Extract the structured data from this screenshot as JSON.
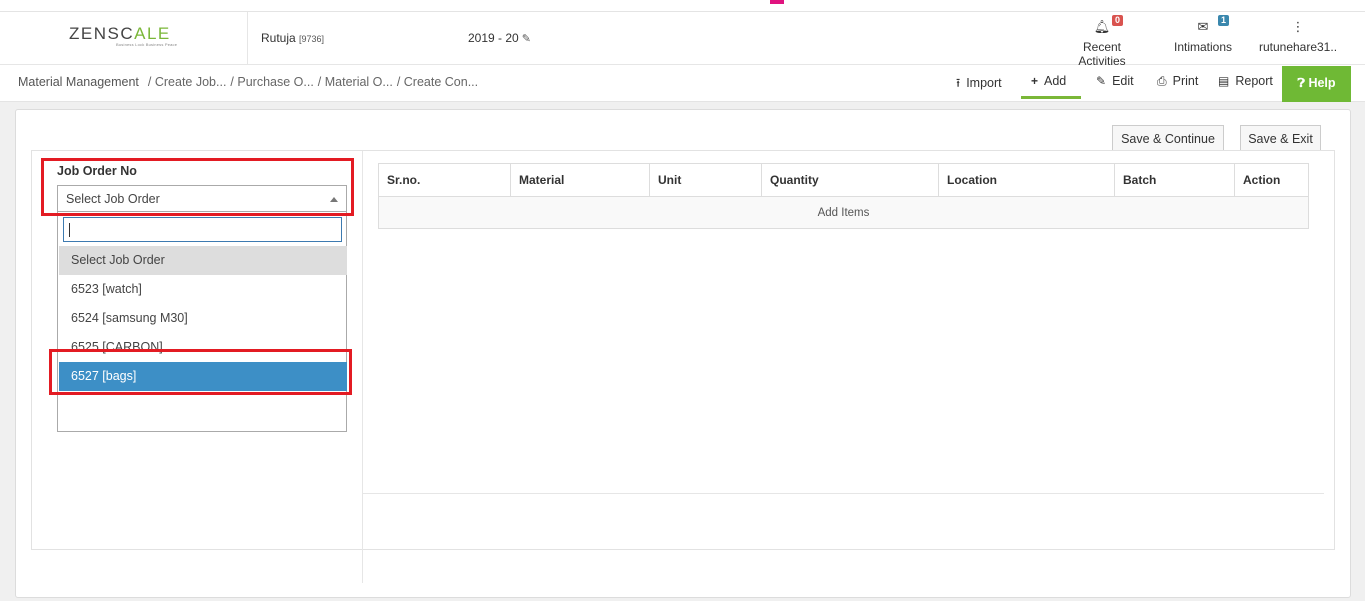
{
  "header": {
    "logo_main": "ZENSC",
    "logo_accent": "ALE",
    "tagline": "Business Lock Business Peace",
    "user": "Rutuja",
    "user_id": "[9736]",
    "financial_year": "2019 - 20",
    "recent_activities": {
      "label": "Recent Activities",
      "count": "0"
    },
    "intimations": {
      "label": "Intimations",
      "count": "1"
    },
    "account": "rutunehare31.."
  },
  "breadcrumb": {
    "items": [
      "Material Management",
      "/ Create Job...",
      "/ Purchase O...",
      "/ Material O...",
      "/ Create Con..."
    ]
  },
  "toolbar": {
    "import": "Import",
    "add": "Add",
    "edit": "Edit",
    "print": "Print",
    "report": "Report",
    "help": "Help"
  },
  "actions": {
    "save_continue": "Save & Continue",
    "save_exit": "Save & Exit"
  },
  "job_order": {
    "label": "Job Order No",
    "selected": "Select Job Order",
    "search_value": "",
    "options": [
      "Select Job Order",
      "6523 [watch]",
      "6524 [samsung M30]",
      "6525 [CARBON]",
      "6527 [bags]"
    ]
  },
  "items_table": {
    "columns": [
      "Sr.no.",
      "Material",
      "Unit",
      "Quantity",
      "Location",
      "Batch",
      "Action"
    ],
    "add_items": "Add Items"
  }
}
